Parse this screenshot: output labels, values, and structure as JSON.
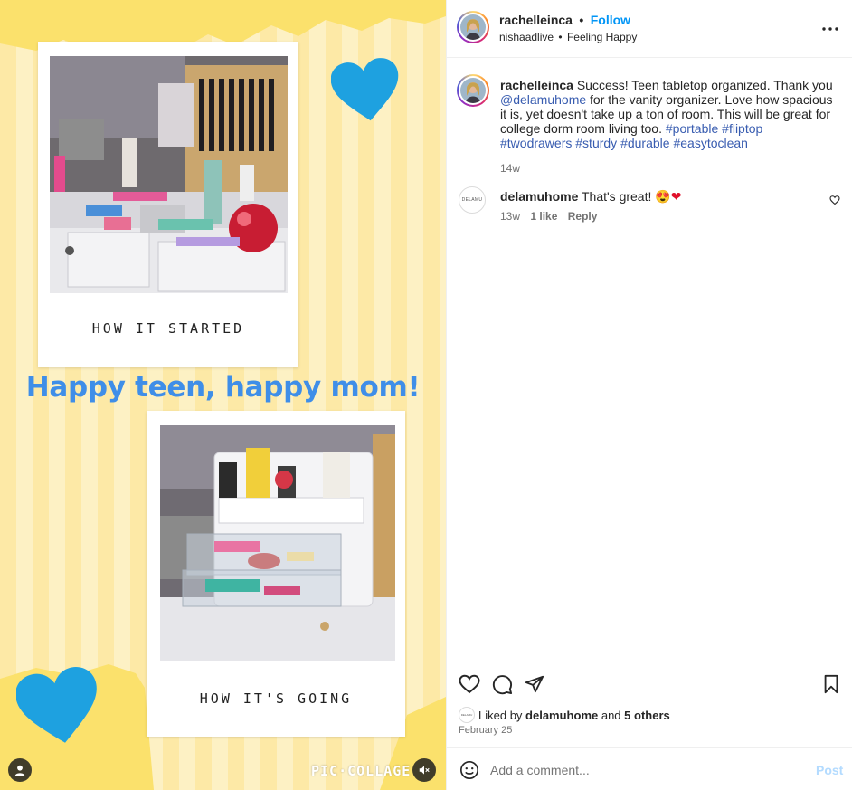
{
  "header": {
    "username": "rachelleinca",
    "dot": "•",
    "follow_label": "Follow",
    "sub_user": "nishaadlive",
    "sub_dot": "•",
    "sub_feeling": "Feeling Happy",
    "more_icon": "more-horizontal-icon"
  },
  "media": {
    "caption_top": "HOW IT STARTED",
    "headline": "Happy teen, happy mom!",
    "caption_bottom": "HOW IT'S GOING",
    "watermark": "PIC·COLLAGE",
    "heart_color": "#1ea1e0",
    "headline_color": "#3f8ee8"
  },
  "caption": {
    "username": "rachelleinca",
    "text_1": " Success! Teen tabletop organized. Thank you ",
    "mention": "@delamuhome",
    "text_2": " for the vanity organizer. Love how spacious it is, yet doesn't take up a ton of room. This will be great for college dorm room living too. ",
    "hashtags": [
      "#portable",
      "#fliptop",
      "#twodrawers",
      "#sturdy",
      "#durable",
      "#easytoclean"
    ],
    "age": "14w"
  },
  "comment": {
    "avatar_text": "DELAMU",
    "username": "delamuhome",
    "text": " That's great!",
    "emoji_1": "😍",
    "emoji_2": "❤",
    "age": "13w",
    "likes": "1 like",
    "reply_label": "Reply"
  },
  "actions": {
    "like_icon": "heart-outline-icon",
    "comment_icon": "comment-icon",
    "share_icon": "send-icon",
    "save_icon": "bookmark-icon"
  },
  "likes": {
    "prefix": "Liked by ",
    "user": "delamuhome",
    "middle": " and ",
    "others": "5 others",
    "date": "February 25"
  },
  "composer": {
    "placeholder": "Add a comment...",
    "post_label": "Post",
    "emoji_icon": "smiley-icon"
  }
}
